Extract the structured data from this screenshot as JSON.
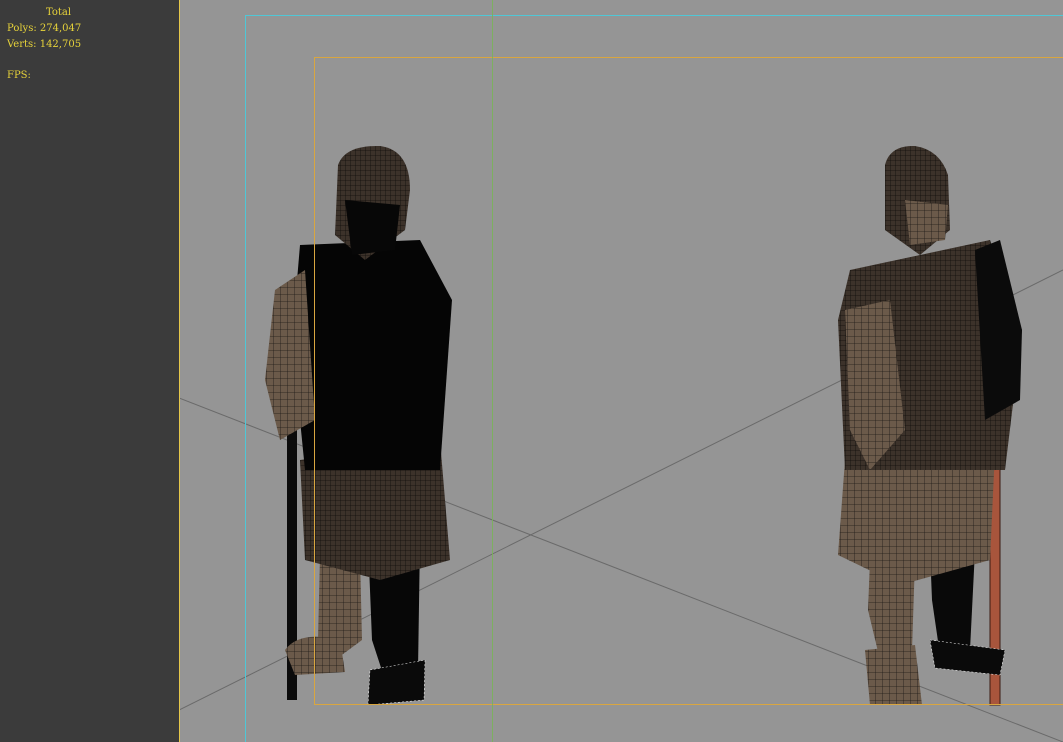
{
  "stats": {
    "title": "Total",
    "polys": "Polys: 274,047",
    "verts": "Verts: 142,705",
    "fps": "FPS:"
  },
  "colors": {
    "stats_text": "#e6d23a",
    "viewport_bg": "#959595",
    "panel_bg": "#3b3b3b",
    "outer_frame": "#4fc7d6",
    "inner_frame": "#d9a640",
    "center_line": "#7ab35a"
  },
  "scene": {
    "models": [
      {
        "name": "warrior-left",
        "shading": "dark wireframe"
      },
      {
        "name": "warrior-right",
        "shading": "textured wireframe"
      }
    ]
  }
}
